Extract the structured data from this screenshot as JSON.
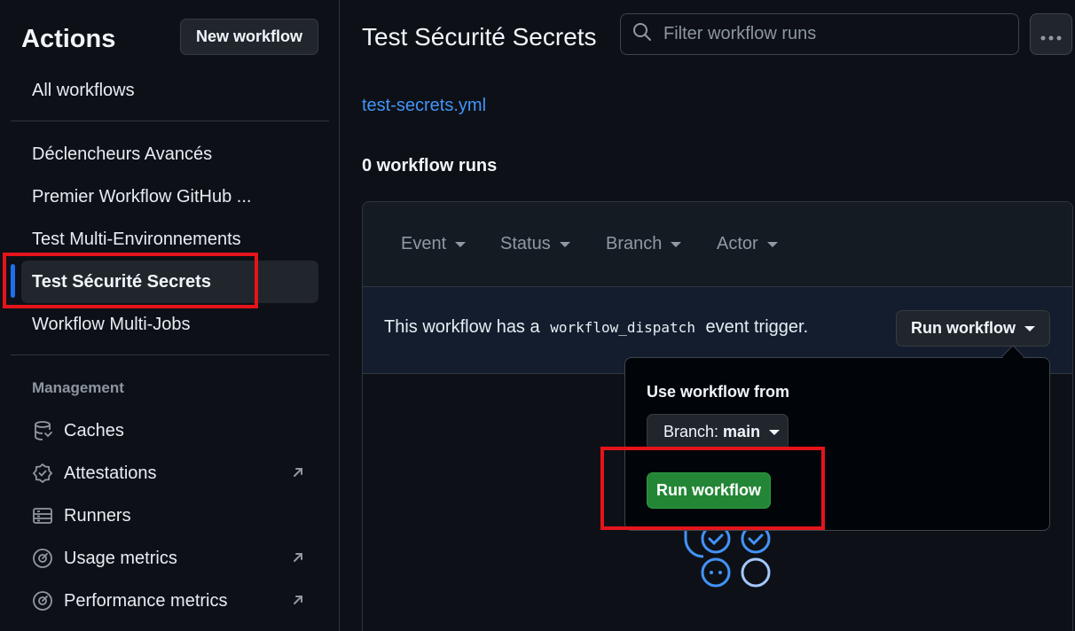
{
  "sidebar": {
    "title": "Actions",
    "new_workflow_label": "New workflow",
    "all_workflows": "All workflows",
    "workflows": [
      {
        "label": "Déclencheurs Avancés"
      },
      {
        "label": "Premier Workflow GitHub ..."
      },
      {
        "label": "Test Multi-Environnements"
      },
      {
        "label": "Test Sécurité Secrets",
        "active": true
      },
      {
        "label": "Workflow Multi-Jobs"
      }
    ],
    "management_label": "Management",
    "management": [
      {
        "label": "Caches",
        "icon": "database-icon"
      },
      {
        "label": "Attestations",
        "icon": "verified-icon",
        "external": true
      },
      {
        "label": "Runners",
        "icon": "server-icon"
      },
      {
        "label": "Usage metrics",
        "icon": "meter-icon",
        "external": true
      },
      {
        "label": "Performance metrics",
        "icon": "meter-icon",
        "external": true
      }
    ]
  },
  "header": {
    "title": "Test Sécurité Secrets",
    "file": "test-secrets.yml",
    "runs_count": "0 workflow runs",
    "search_placeholder": "Filter workflow runs"
  },
  "filters": [
    "Event",
    "Status",
    "Branch",
    "Actor"
  ],
  "dispatch": {
    "text_before": "This workflow has a",
    "code": "workflow_dispatch",
    "text_after": "event trigger.",
    "button_label": "Run workflow"
  },
  "popover": {
    "heading": "Use workflow from",
    "branch_prefix": "Branch:",
    "branch_value": "main",
    "run_label": "Run workflow"
  },
  "colors": {
    "accent": "#1f6feb",
    "link": "#4493f8",
    "run_button": "#238636",
    "highlight": "#e5141b"
  }
}
